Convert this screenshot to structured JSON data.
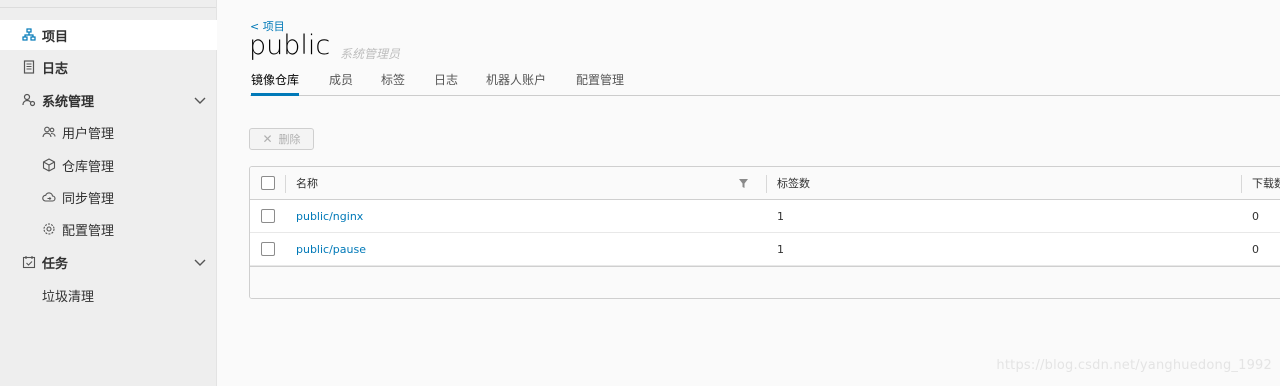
{
  "sidebar": {
    "items": [
      {
        "label": "项目",
        "icon": "project-icon"
      },
      {
        "label": "日志",
        "icon": "log-icon"
      },
      {
        "label": "系统管理",
        "icon": "admin-icon"
      },
      {
        "label": "用户管理",
        "icon": "users-icon"
      },
      {
        "label": "仓库管理",
        "icon": "registry-icon"
      },
      {
        "label": "同步管理",
        "icon": "replication-icon"
      },
      {
        "label": "配置管理",
        "icon": "gear-icon"
      },
      {
        "label": "任务",
        "icon": "task-icon"
      },
      {
        "label": "垃圾清理",
        "icon": ""
      }
    ]
  },
  "header": {
    "back_label": "< 项目",
    "title": "public",
    "role": "系统管理员"
  },
  "tabs": [
    {
      "label": "镜像仓库"
    },
    {
      "label": "成员"
    },
    {
      "label": "标签"
    },
    {
      "label": "日志"
    },
    {
      "label": "机器人账户"
    },
    {
      "label": "配置管理"
    }
  ],
  "toolbar": {
    "delete_label": "删除"
  },
  "table": {
    "columns": [
      "名称",
      "标签数",
      "下载数"
    ],
    "rows": [
      {
        "name": "public/nginx",
        "tags": "1",
        "pulls": "0"
      },
      {
        "name": "public/pause",
        "tags": "1",
        "pulls": "0"
      }
    ]
  },
  "watermark": "https://blog.csdn.net/yanghuedong_1992",
  "colors": {
    "accent": "#0079b8",
    "sidebar_bg": "#eeeeee",
    "page_bg": "#fafafa"
  }
}
